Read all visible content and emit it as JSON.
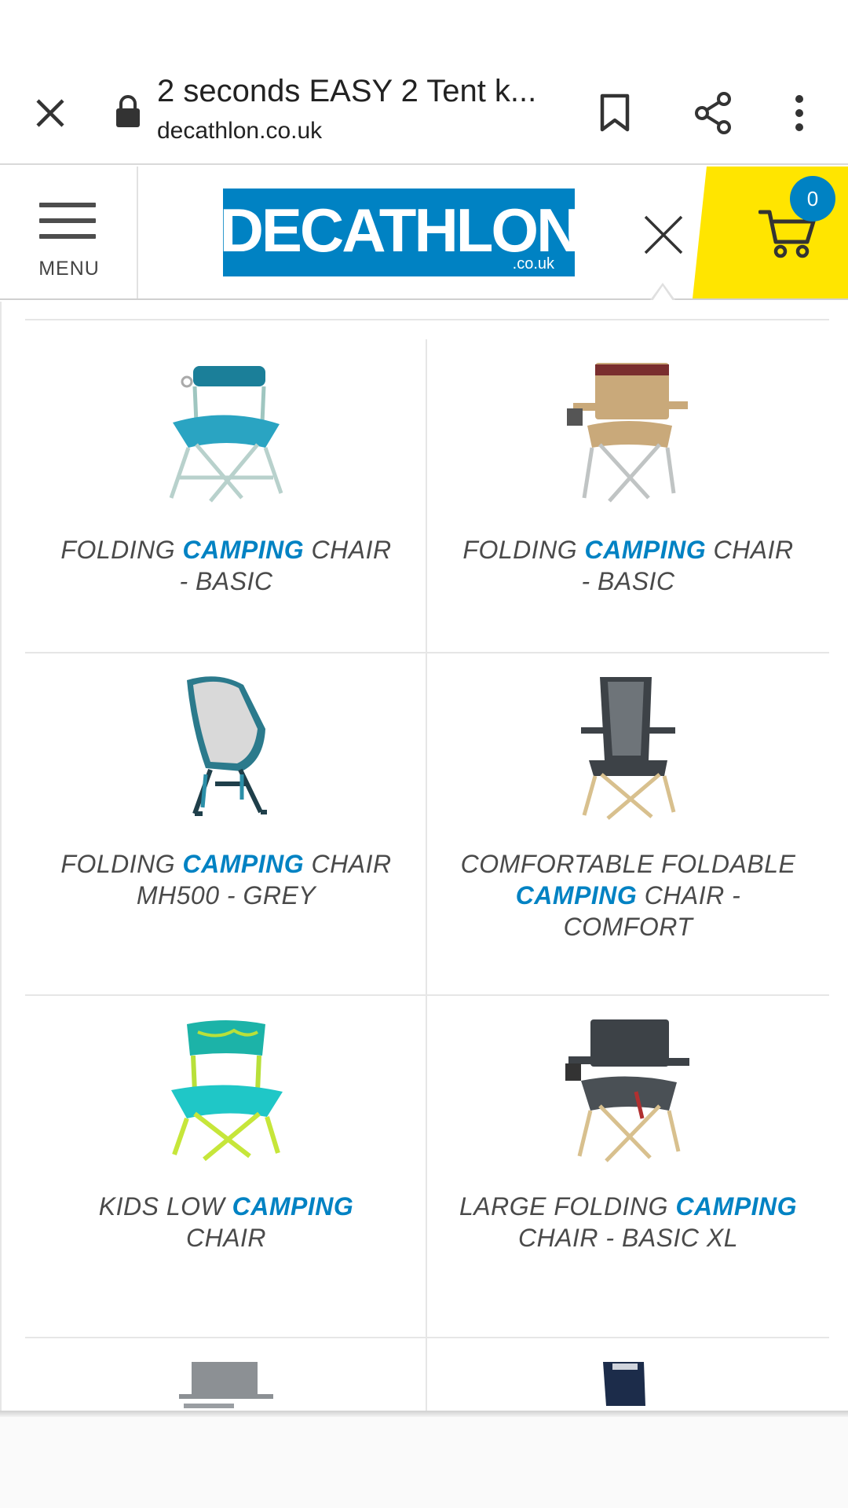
{
  "browser": {
    "title": "2 seconds EASY 2 Tent k...",
    "url": "decathlon.co.uk"
  },
  "header": {
    "menu_label": "MENU",
    "logo_text": "DECATHLON",
    "logo_sub": ".co.uk",
    "cart_count": "0"
  },
  "colors": {
    "brand_blue": "#0082c3",
    "cart_yellow": "#ffe500",
    "text_grey": "#4a4a4a"
  },
  "products": [
    {
      "name_before": "FOLDING ",
      "highlight": "CAMPING",
      "name_after": " CHAIR - BASIC",
      "image": "chair-teal-basic-icon"
    },
    {
      "name_before": "FOLDING ",
      "highlight": "CAMPING",
      "name_after": " CHAIR - BASIC",
      "image": "chair-beige-armrest-icon"
    },
    {
      "name_before": "FOLDING ",
      "highlight": "CAMPING",
      "name_after": " CHAIR MH500 - GREY",
      "image": "chair-grey-mh500-icon"
    },
    {
      "name_before": "COMFORTABLE FOLDABLE ",
      "highlight": "CAMPING",
      "name_after": " CHAIR - COMFORT",
      "image": "chair-grey-comfort-icon"
    },
    {
      "name_before": "KIDS LOW ",
      "highlight": "CAMPING",
      "name_after": " CHAIR",
      "image": "chair-kids-turquoise-icon"
    },
    {
      "name_before": "LARGE FOLDING ",
      "highlight": "CAMPING",
      "name_after": " CHAIR - BASIC XL",
      "image": "chair-grey-xl-icon"
    }
  ]
}
